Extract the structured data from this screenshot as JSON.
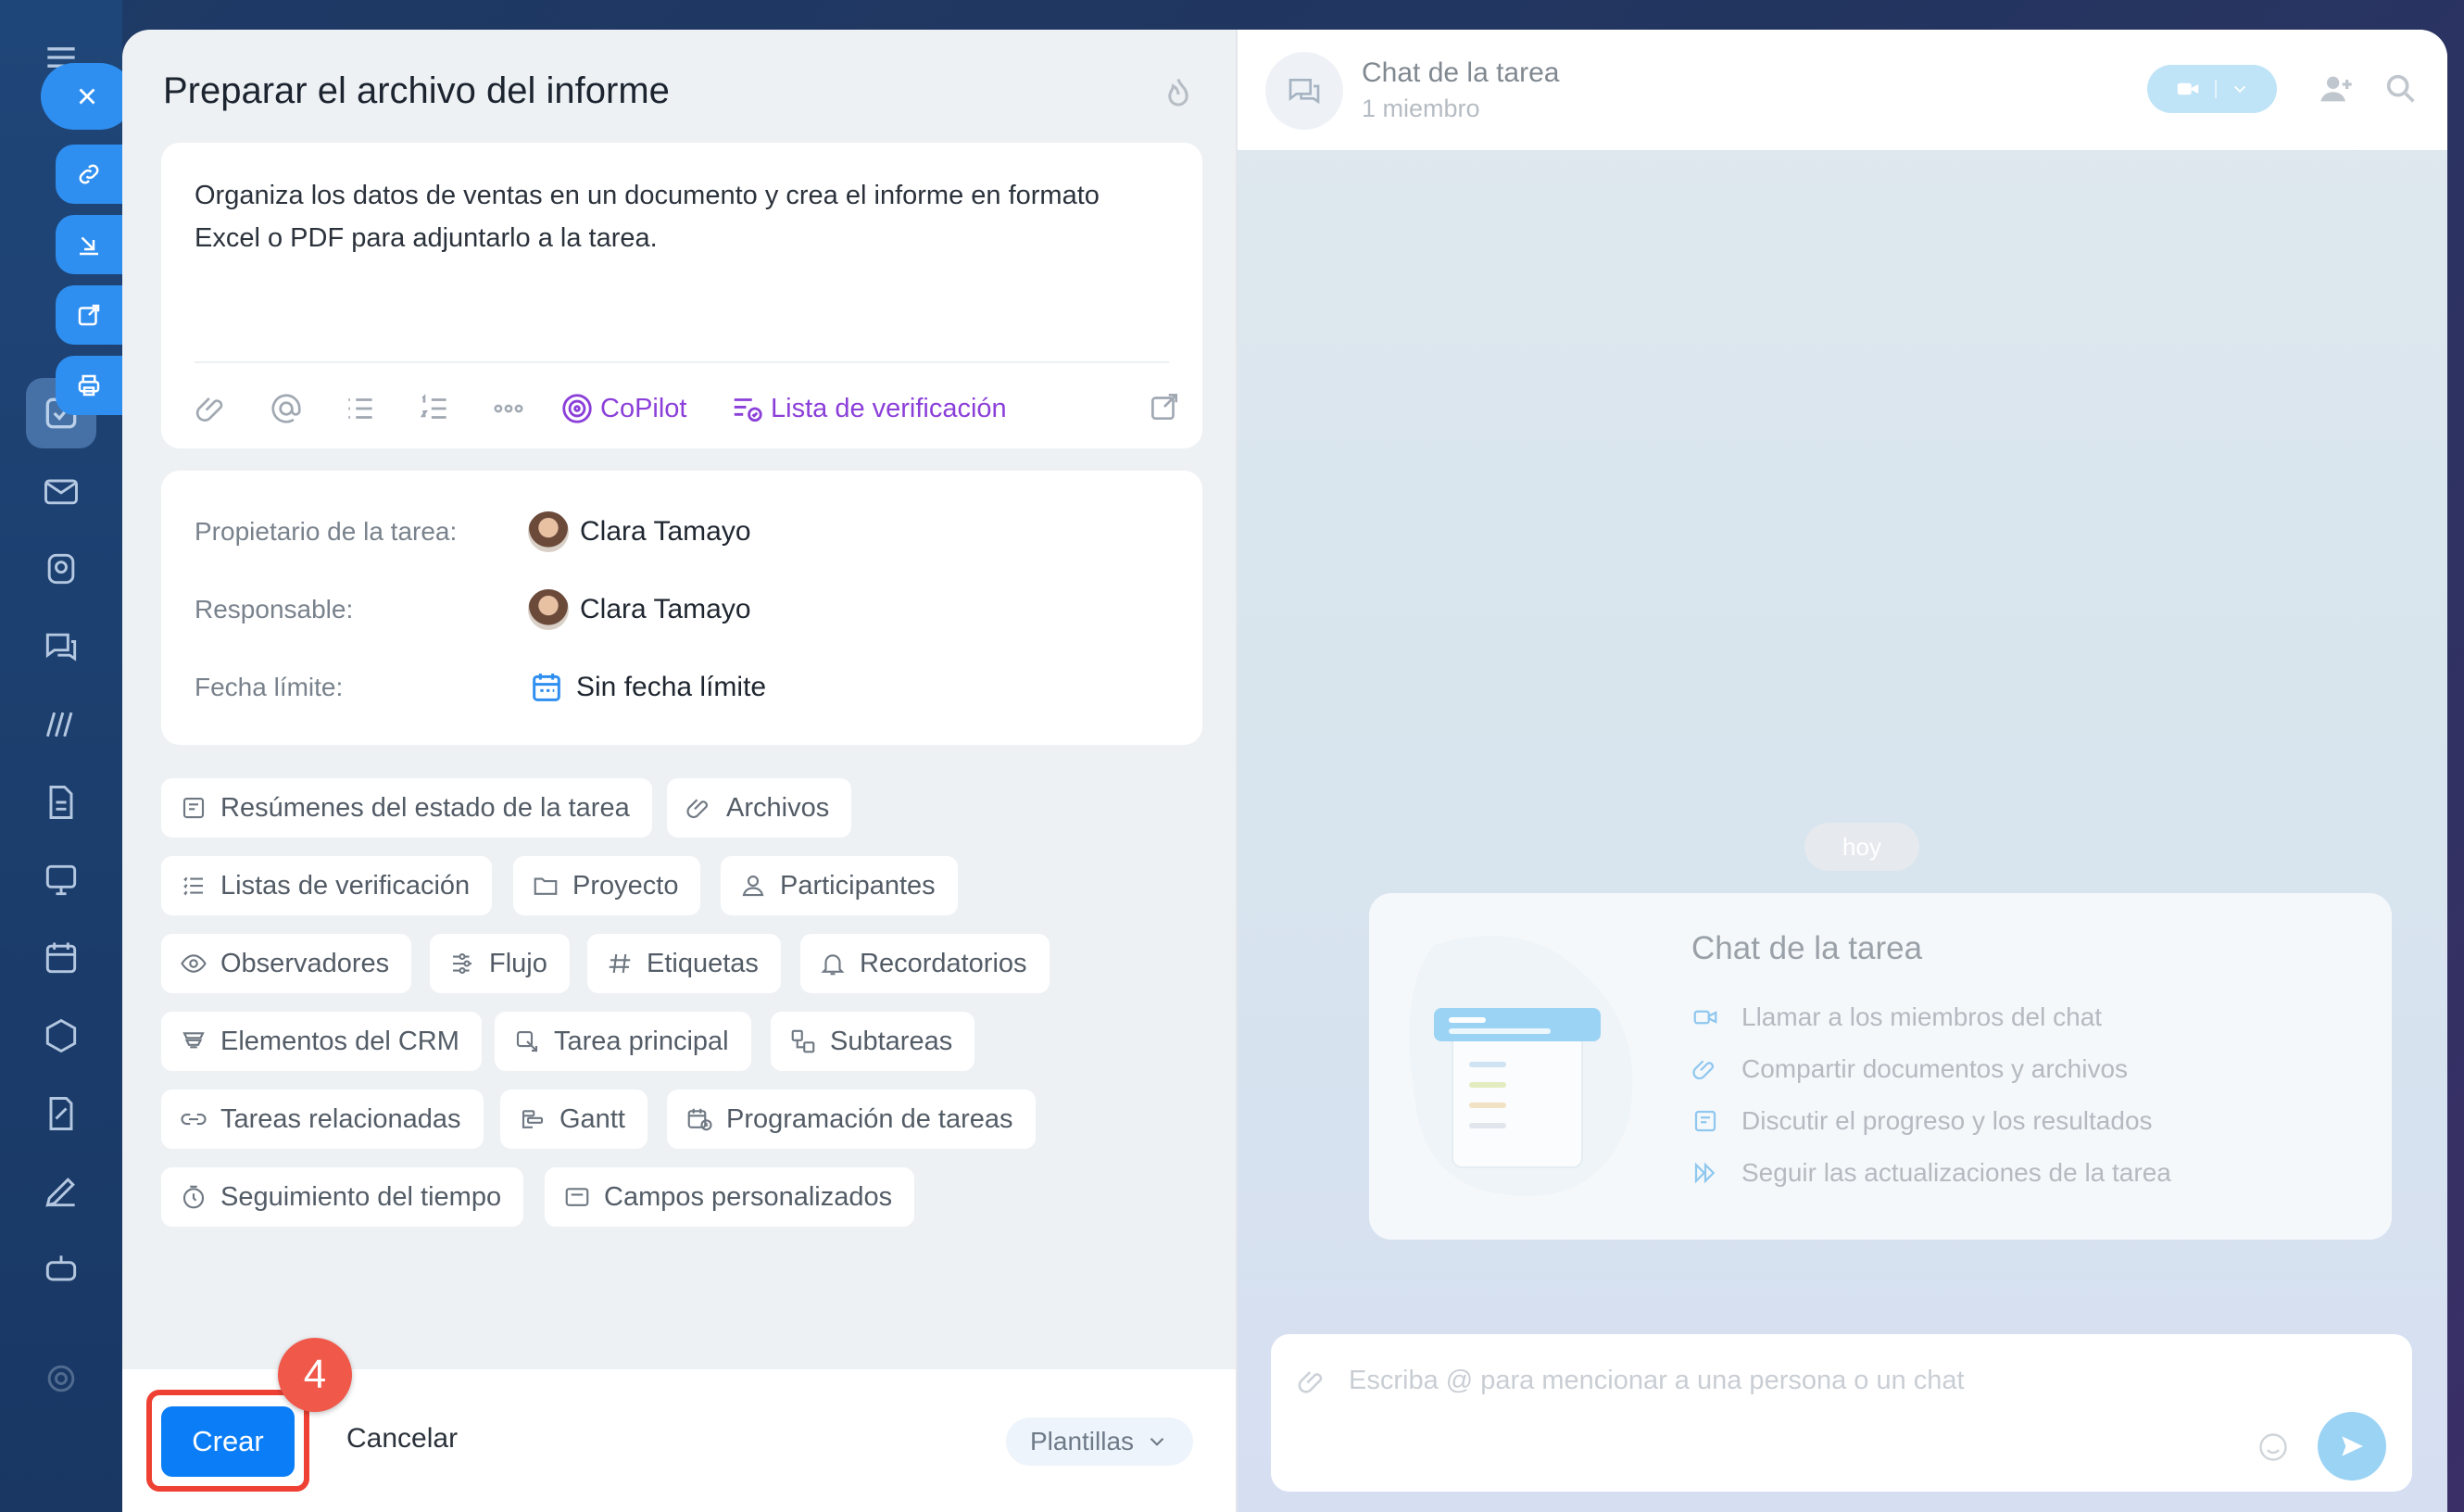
{
  "panel": {
    "title": "Preparar el archivo del informe",
    "description": "Organiza los datos de ventas en un documento y crea el informe en formato Excel o PDF para adjuntarlo a la tarea."
  },
  "toolbar": {
    "copilot": "CoPilot",
    "checklist": "Lista de verificación"
  },
  "fields": {
    "owner_label": "Propietario de la tarea:",
    "owner_value": "Clara Tamayo",
    "responsible_label": "Responsable:",
    "responsible_value": "Clara Tamayo",
    "deadline_label": "Fecha límite:",
    "deadline_value": "Sin fecha límite"
  },
  "chips": [
    "Resúmenes del estado de la tarea",
    "Archivos",
    "Listas de verificación",
    "Proyecto",
    "Participantes",
    "Observadores",
    "Flujo",
    "Etiquetas",
    "Recordatorios",
    "Elementos del CRM",
    "Tarea principal",
    "Subtareas",
    "Tareas relacionadas",
    "Gantt",
    "Programación de tareas",
    "Seguimiento del tiempo",
    "Campos personalizados"
  ],
  "footer": {
    "create": "Crear",
    "cancel": "Cancelar",
    "templates": "Plantillas",
    "step": "4"
  },
  "chat": {
    "title": "Chat de la tarea",
    "members": "1 miembro",
    "date_badge": "hoy",
    "intro_title": "Chat de la tarea",
    "features": [
      "Llamar a los miembros del chat",
      "Compartir documentos y archivos",
      "Discutir el progreso y los resultados",
      "Seguir las actualizaciones de la tarea"
    ],
    "placeholder": "Escriba @ para mencionar a una persona o un chat"
  },
  "colors": {
    "primary": "#0b7ef7",
    "accent_purple": "#8b3fd9",
    "highlight": "#ee4134"
  }
}
